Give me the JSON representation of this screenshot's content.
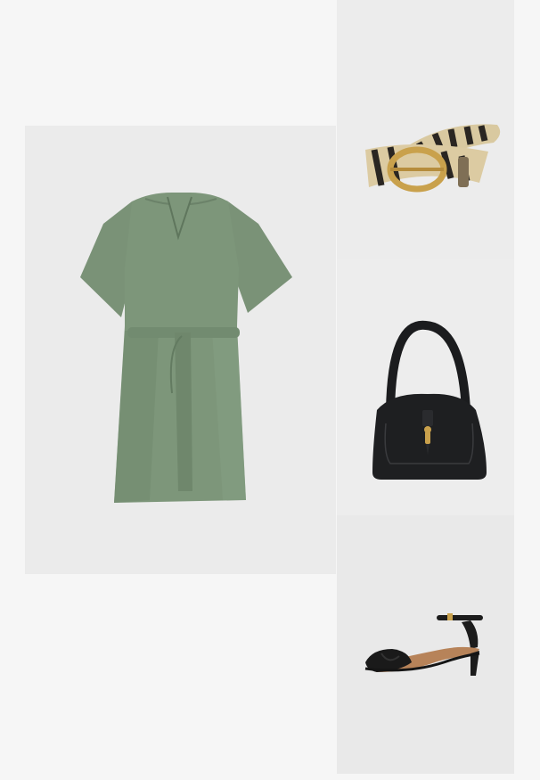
{
  "outfit": {
    "items": [
      {
        "id": "dress",
        "icon": "green-tunic-dress-icon",
        "color": "#7b9379"
      },
      {
        "id": "belt",
        "icon": "zebra-print-belt-icon",
        "color": "#d9c9a0"
      },
      {
        "id": "bag",
        "icon": "black-hobo-bag-icon",
        "color": "#1e1f21"
      },
      {
        "id": "sandals",
        "icon": "black-heeled-sandal-icon",
        "color": "#1c1c1c"
      }
    ]
  }
}
